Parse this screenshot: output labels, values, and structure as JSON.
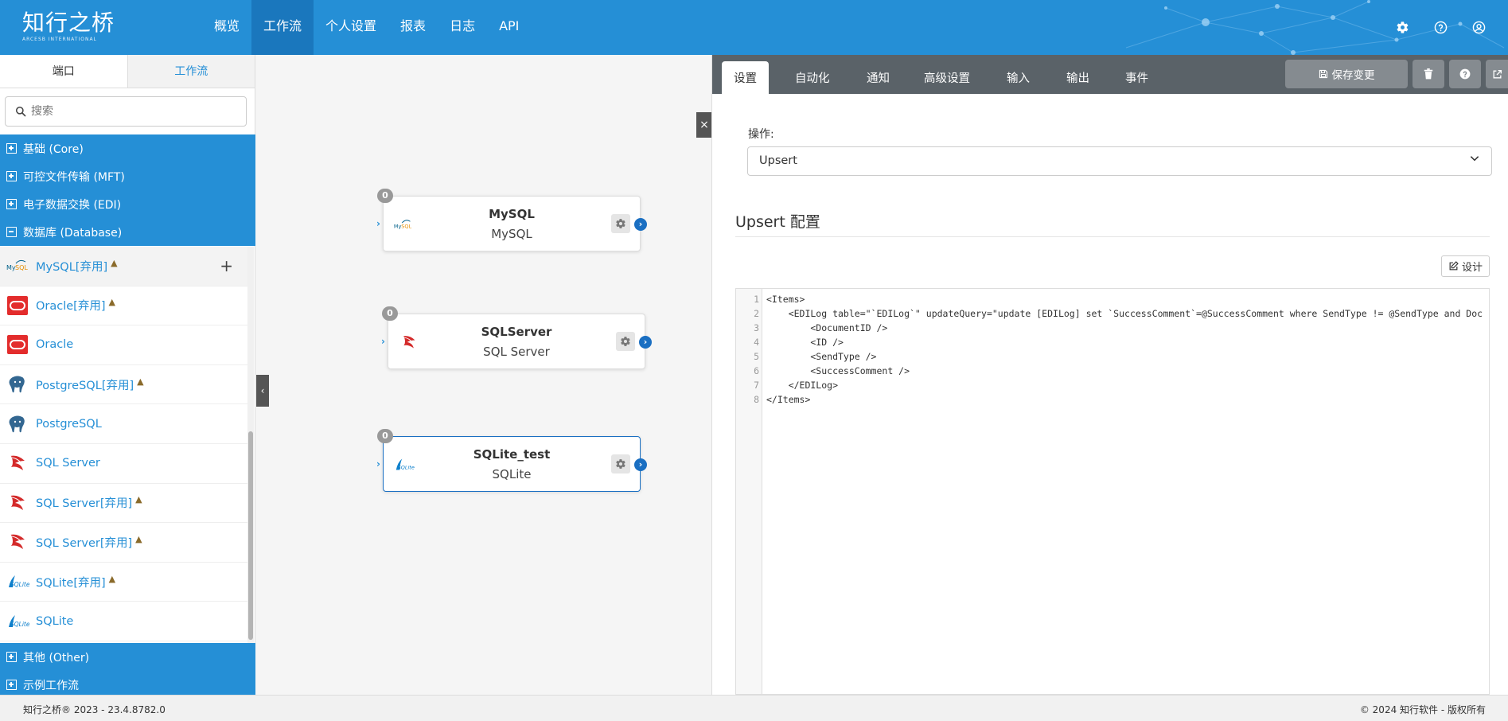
{
  "brand": {
    "name_cn": "知行之桥",
    "name_en": "ARCESB INTERNATIONAL"
  },
  "nav": {
    "items": [
      {
        "label": "概览",
        "active": false
      },
      {
        "label": "工作流",
        "active": true
      },
      {
        "label": "个人设置",
        "active": false
      },
      {
        "label": "报表",
        "active": false
      },
      {
        "label": "日志",
        "active": false
      },
      {
        "label": "API",
        "active": false
      }
    ],
    "icons": [
      "gear-icon",
      "help-icon",
      "user-icon"
    ]
  },
  "sidebar": {
    "tabs": [
      {
        "label": "端口",
        "active": true
      },
      {
        "label": "工作流",
        "active": false
      }
    ],
    "search": {
      "placeholder": "搜索",
      "value": ""
    },
    "categories": [
      {
        "label": "基础 (Core)",
        "expanded": false
      },
      {
        "label": "可控文件传输 (MFT)",
        "expanded": false
      },
      {
        "label": "电子数据交换 (EDI)",
        "expanded": false
      },
      {
        "label": "数据库 (Database)",
        "expanded": true
      }
    ],
    "items": [
      {
        "label": "MySQL[弃用]",
        "icon": "mysql-icon",
        "deprecated": true
      },
      {
        "label": "Oracle[弃用]",
        "icon": "oracle-icon",
        "deprecated": true
      },
      {
        "label": "Oracle",
        "icon": "oracle-icon",
        "deprecated": false
      },
      {
        "label": "PostgreSQL[弃用]",
        "icon": "postgresql-icon",
        "deprecated": true
      },
      {
        "label": "PostgreSQL",
        "icon": "postgresql-icon",
        "deprecated": false
      },
      {
        "label": "SQL Server",
        "icon": "sqlserver-icon",
        "deprecated": false
      },
      {
        "label": "SQL Server[弃用]",
        "icon": "sqlserver-icon",
        "deprecated": true
      },
      {
        "label": "SQL Server[弃用]",
        "icon": "sqlserver-icon",
        "deprecated": true
      },
      {
        "label": "SQLite[弃用]",
        "icon": "sqlite-icon",
        "deprecated": true
      },
      {
        "label": "SQLite",
        "icon": "sqlite-icon",
        "deprecated": false
      }
    ],
    "categories_bottom": [
      {
        "label": "其他 (Other)",
        "expanded": false
      },
      {
        "label": "示例工作流",
        "expanded": false
      }
    ]
  },
  "canvas": {
    "nodes": [
      {
        "title": "MySQL",
        "subtitle": "MySQL",
        "count": "0",
        "icon": "mysql-icon",
        "selected": false
      },
      {
        "title": "SQLServer",
        "subtitle": "SQL Server",
        "count": "0",
        "icon": "sqlserver-icon",
        "selected": false
      },
      {
        "title": "SQLite_test",
        "subtitle": "SQLite",
        "count": "0",
        "icon": "sqlite-icon",
        "selected": true
      }
    ]
  },
  "panel": {
    "tabs": [
      {
        "label": "设置",
        "active": true
      },
      {
        "label": "自动化",
        "active": false
      },
      {
        "label": "通知",
        "active": false
      },
      {
        "label": "高级设置",
        "active": false
      },
      {
        "label": "输入",
        "active": false
      },
      {
        "label": "输出",
        "active": false
      },
      {
        "label": "事件",
        "active": false
      }
    ],
    "save_label": "保存变更",
    "operation_label": "操作:",
    "operation_value": "Upsert",
    "config_title": "Upsert 配置",
    "design_label": "设计",
    "code_lines": [
      "<Items>",
      "    <EDILog table=\"`EDILog`\" updateQuery=\"update [EDILog] set `SuccessComment`=@SuccessComment where SendType != @SendType and Doc",
      "        <DocumentID />",
      "        <ID />",
      "        <SendType />",
      "        <SuccessComment />",
      "    </EDILog>",
      "</Items>"
    ]
  },
  "footer": {
    "left": "知行之桥® 2023 - 23.4.8782.0",
    "right": "© 2024 知行软件 - 版权所有"
  },
  "colors": {
    "primary": "#258fd6",
    "nav_active": "#1a77bd",
    "panel_tabbar": "#5a6268",
    "node_port": "#1a6fc2"
  }
}
